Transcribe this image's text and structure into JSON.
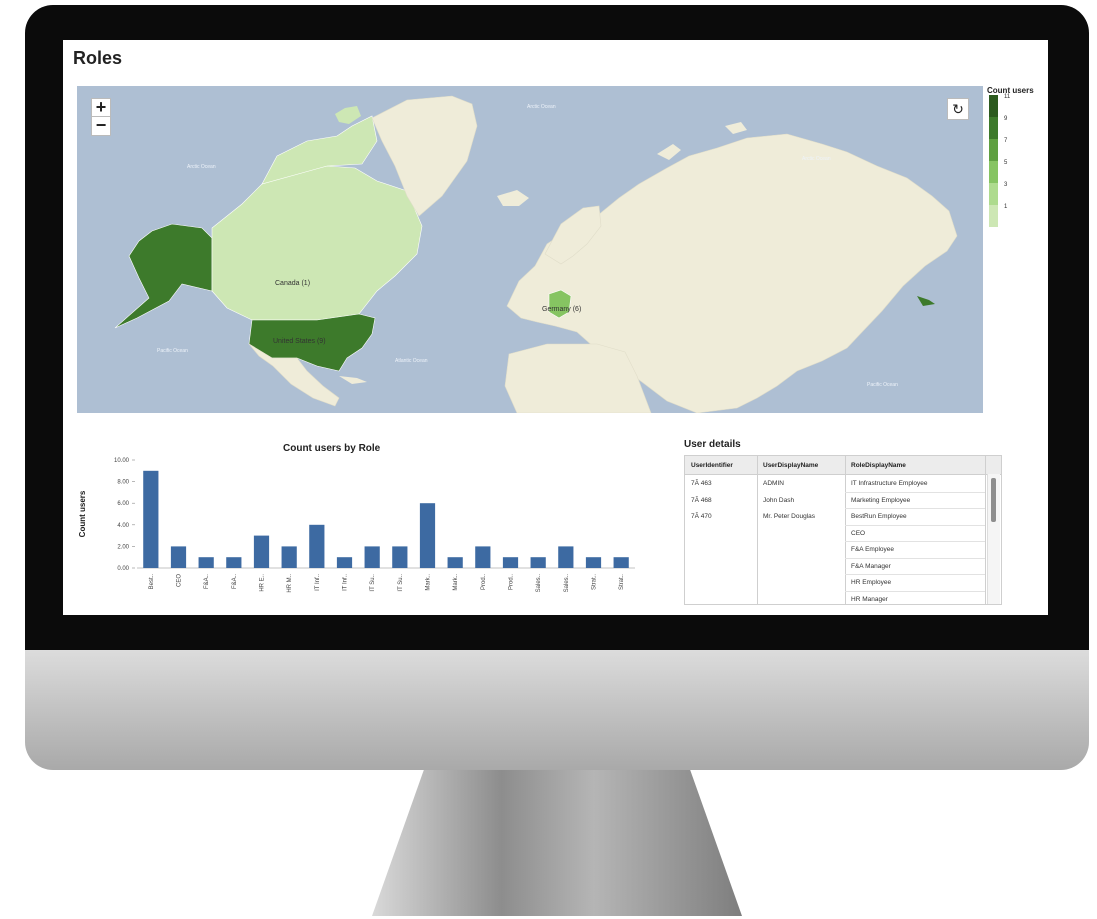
{
  "page": {
    "title": "Roles"
  },
  "map": {
    "zoom_in": "+",
    "zoom_out": "−",
    "reset_glyph": "↻",
    "country_labels": [
      {
        "name": "Canada (1)"
      },
      {
        "name": "United States (9)"
      },
      {
        "name": "Germany (6)"
      }
    ],
    "ocean_labels": [
      "Arctic Ocean",
      "Arctic Ocean",
      "Arctic Ocean",
      "Pacific Ocean",
      "Atlantic Ocean",
      "Pacific Ocean"
    ],
    "colors": {
      "water": "#aebfd3",
      "land": "#efecd9",
      "scale": [
        "#cde7b4",
        "#aedb8e",
        "#86c462",
        "#5fa041",
        "#3d7a2b",
        "#2c5a1e"
      ]
    }
  },
  "legend": {
    "title": "Count users",
    "labels": [
      "11",
      "9",
      "7",
      "5",
      "3",
      "1"
    ]
  },
  "chart": {
    "title": "Count users by Role"
  },
  "chart_data": {
    "type": "bar",
    "title": "Count users by Role",
    "xlabel": "",
    "ylabel": "Count users",
    "ylim": [
      0,
      10
    ],
    "yticks": [
      "10.00",
      "8.00",
      "6.00",
      "4.00",
      "2.00",
      "0.00"
    ],
    "categories": [
      "Best..",
      "CEO",
      "F&A..",
      "F&A..",
      "HR E..",
      "HR M..",
      "IT Inf..",
      "IT Inf..",
      "IT Su..",
      "IT Su..",
      "Mark..",
      "Mark..",
      "Prod..",
      "Prod..",
      "Sales..",
      "Sales..",
      "Strat..",
      "Strat.."
    ],
    "values": [
      9,
      2,
      1,
      1,
      3,
      2,
      4,
      1,
      2,
      2,
      6,
      1,
      2,
      1,
      1,
      2,
      1,
      1
    ],
    "bar_color": "#3d6aa2",
    "grid": false
  },
  "details": {
    "title": "User details",
    "columns": [
      "UserIdentifier",
      "UserDisplayName",
      "RoleDisplayName"
    ],
    "ids": [
      "7Ã 463",
      "7Ã 468",
      "7Ã 470"
    ],
    "names": [
      "ADMIN",
      "John Dash",
      "Mr. Peter Douglas"
    ],
    "roles": [
      "IT Infrastructure Employee",
      "Marketing Employee",
      "BestRun Employee",
      "CEO",
      "F&A Employee",
      "F&A Manager",
      "HR Employee",
      "HR Manager"
    ]
  }
}
